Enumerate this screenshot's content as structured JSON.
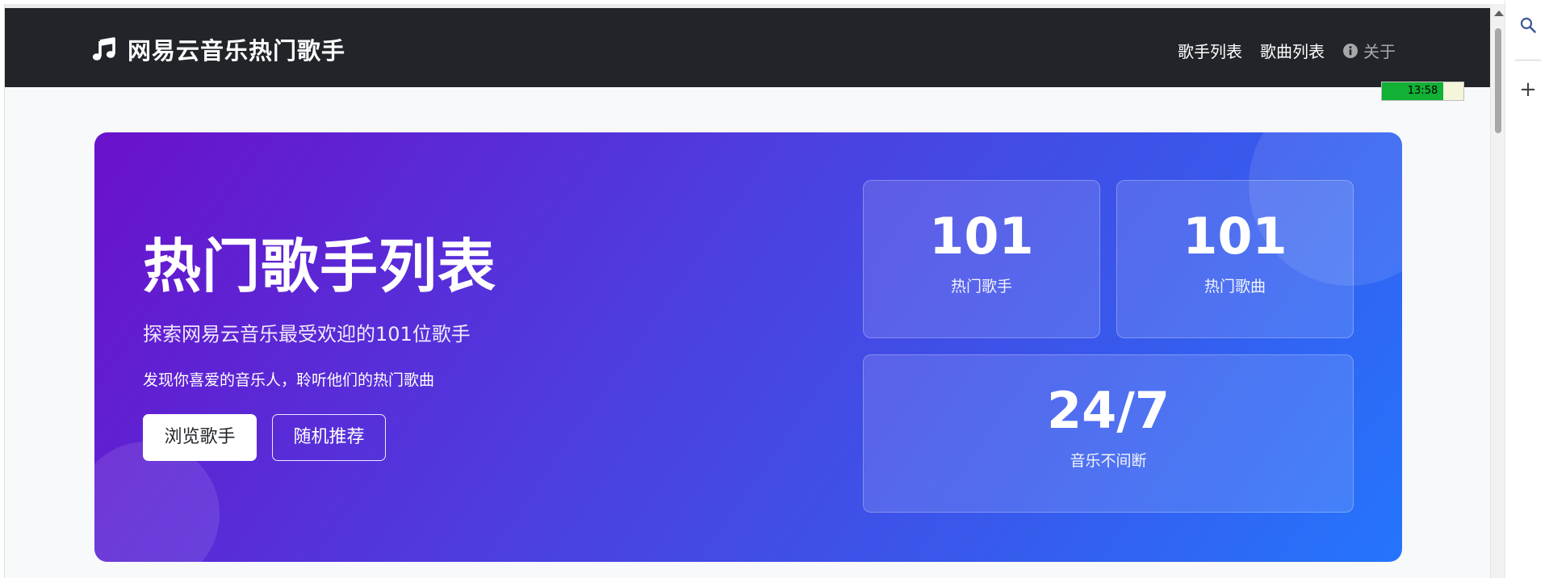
{
  "navbar": {
    "brand": "网易云音乐热门歌手",
    "brand_icon": "music-note-icon",
    "links": [
      {
        "label": "歌手列表"
      },
      {
        "label": "歌曲列表"
      },
      {
        "label": "关于",
        "icon": "info-circle-icon"
      }
    ]
  },
  "clock": {
    "time": "13:58",
    "progress_percent": 75,
    "fill_color": "#12b035"
  },
  "hero": {
    "title": "热门歌手列表",
    "subtitle": "探索网易云音乐最受欢迎的101位歌手",
    "description": "发现你喜爱的音乐人，聆听他们的热门歌曲",
    "primary_button": "浏览歌手",
    "secondary_button": "随机推荐",
    "gradient_start": "#6a11cb",
    "gradient_end": "#2575fc"
  },
  "stats": [
    {
      "number": "101",
      "label": "热门歌手"
    },
    {
      "number": "101",
      "label": "热门歌曲"
    },
    {
      "number": "24/7",
      "label": "音乐不间断"
    }
  ],
  "side_panel": {
    "search_icon": "search-icon",
    "add_icon": "plus-icon",
    "add_label": "+"
  }
}
